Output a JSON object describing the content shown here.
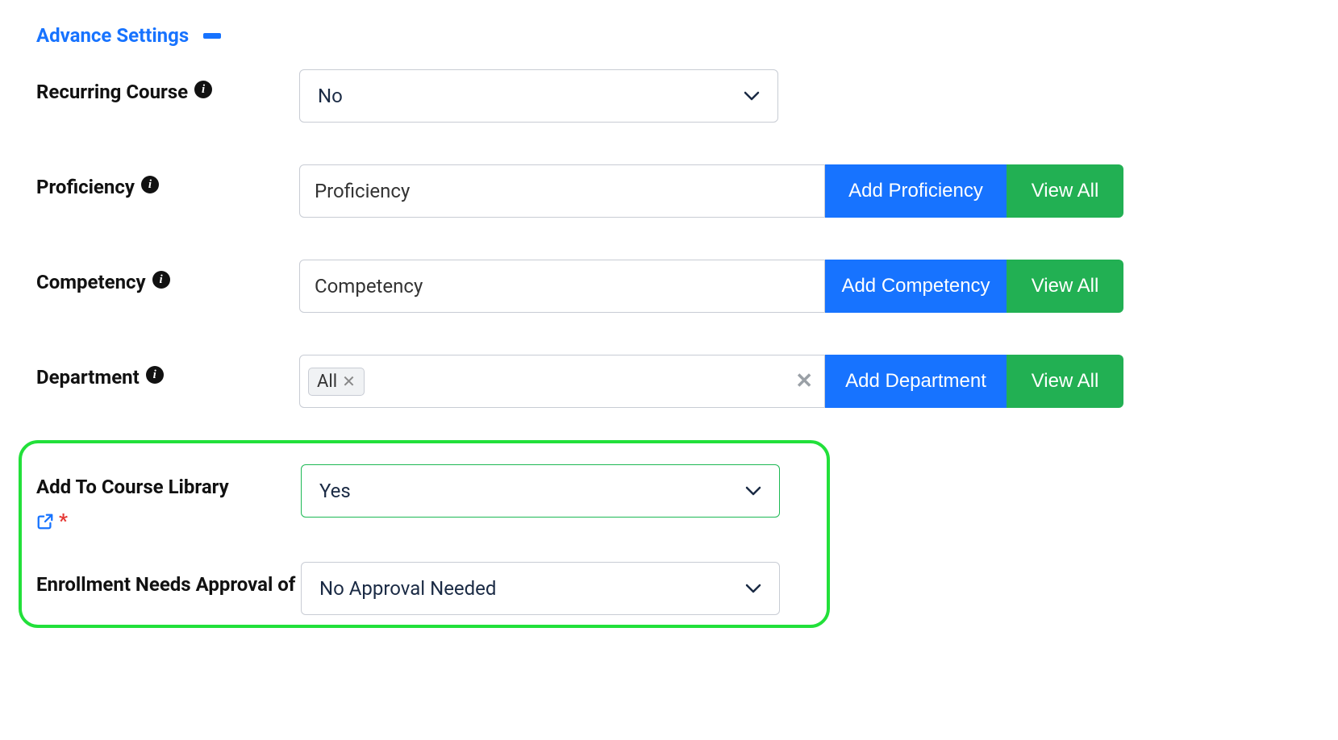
{
  "section": {
    "title": "Advance Settings"
  },
  "fields": {
    "recurring": {
      "label": "Recurring Course",
      "value": "No"
    },
    "proficiency": {
      "label": "Proficiency",
      "placeholder": "Proficiency",
      "add_btn": "Add Proficiency",
      "view_btn": "View All"
    },
    "competency": {
      "label": "Competency",
      "placeholder": "Competency",
      "add_btn": "Add Competency",
      "view_btn": "View All"
    },
    "department": {
      "label": "Department",
      "chip": "All",
      "add_btn": "Add Department",
      "view_btn": "View All"
    },
    "library": {
      "label": "Add To Course Library",
      "value": "Yes"
    },
    "approval": {
      "label": "Enrollment Needs Approval of",
      "value": "No Approval Needed"
    }
  }
}
